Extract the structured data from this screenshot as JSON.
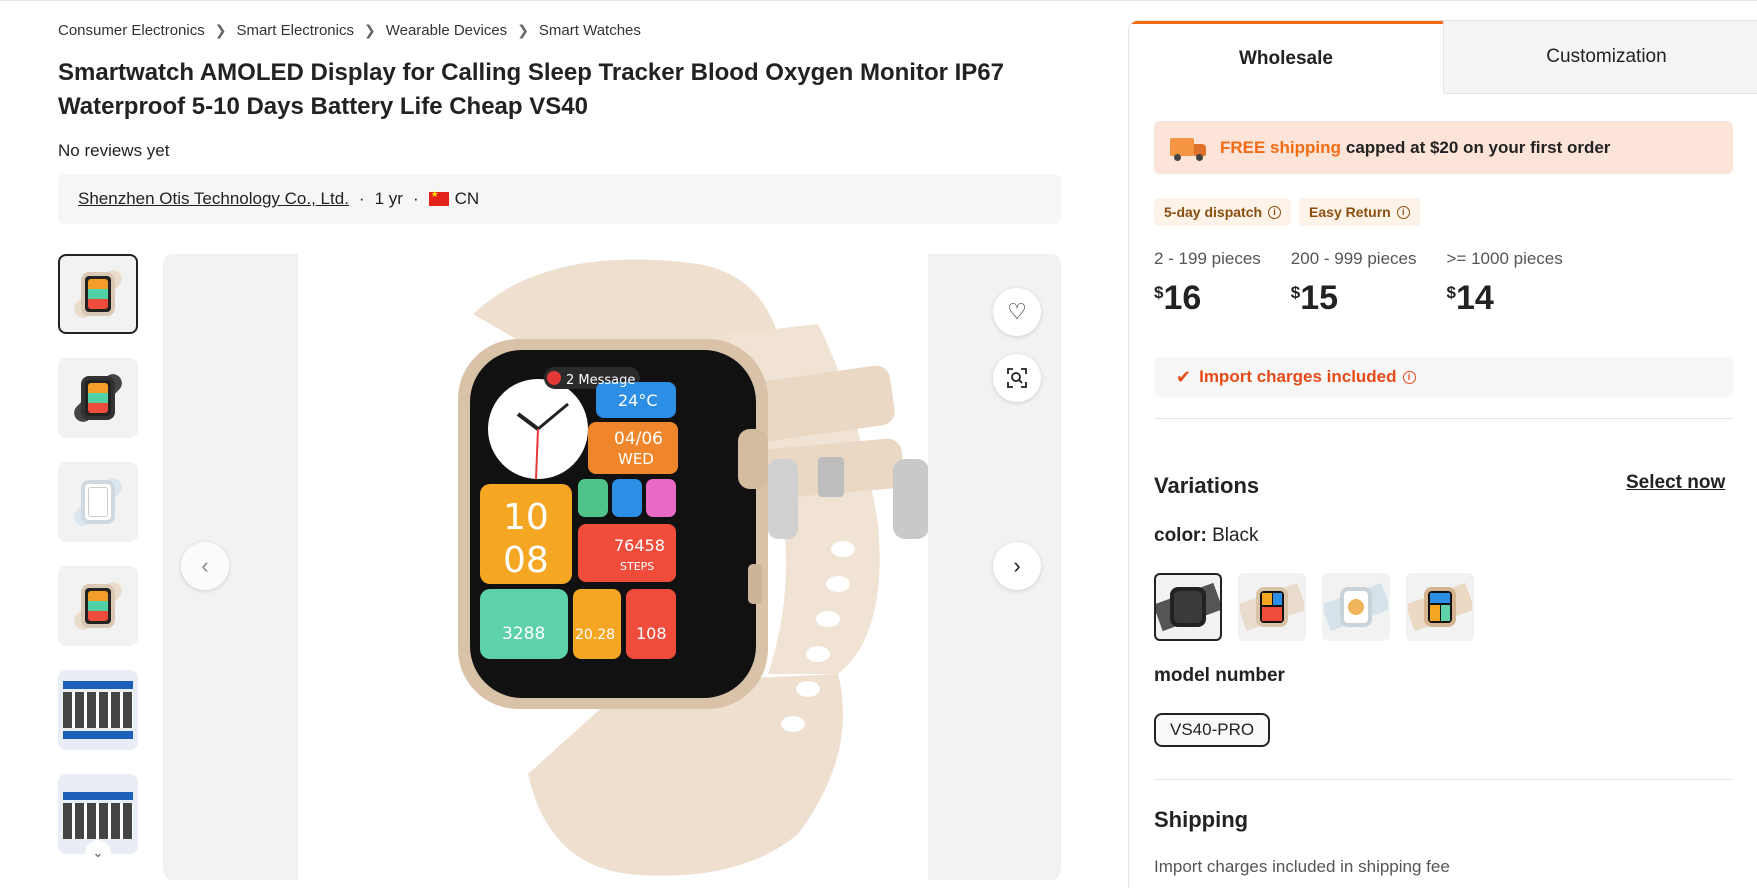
{
  "breadcrumb": [
    "Consumer Electronics",
    "Smart Electronics",
    "Wearable Devices",
    "Smart Watches"
  ],
  "product": {
    "title": "Smartwatch AMOLED Display for Calling Sleep Tracker Blood Oxygen Monitor IP67 Waterproof 5-10 Days Battery Life Cheap VS40",
    "reviews": "No reviews yet"
  },
  "supplier": {
    "name": "Shenzhen Otis Technology Co., Ltd.",
    "years": "1 yr",
    "country": "CN"
  },
  "watch_screen": {
    "message": "2 Message",
    "temp": "24°C",
    "date": "04/06",
    "day": "WED",
    "hour": "10",
    "minute": "08",
    "steps": "76458",
    "steps_label": "STEPS",
    "calories": "3288",
    "distance": "20.28",
    "heart": "108"
  },
  "tabs": [
    "Wholesale",
    "Customization"
  ],
  "promo": {
    "free": "FREE shipping",
    "rest": "capped at $20 on your first order"
  },
  "badges": [
    "5-day dispatch",
    "Easy Return"
  ],
  "tiers": [
    {
      "qty": "2 - 199 pieces",
      "currency": "$",
      "price": "16"
    },
    {
      "qty": "200 - 999 pieces",
      "currency": "$",
      "price": "15"
    },
    {
      "qty": ">= 1000 pieces",
      "currency": "$",
      "price": "14"
    }
  ],
  "import_charges": "Import charges included",
  "variations": {
    "title": "Variations",
    "select_now": "Select now",
    "color_label": "color:",
    "color_value": "Black",
    "model_label": "model number",
    "model_value": "VS40-PRO"
  },
  "shipping": {
    "title": "Shipping",
    "note": "Import charges included in shipping fee"
  },
  "colors": {
    "accent": "#f36b12",
    "promo_bg": "#fde4d8",
    "import_red": "#e64a19"
  }
}
